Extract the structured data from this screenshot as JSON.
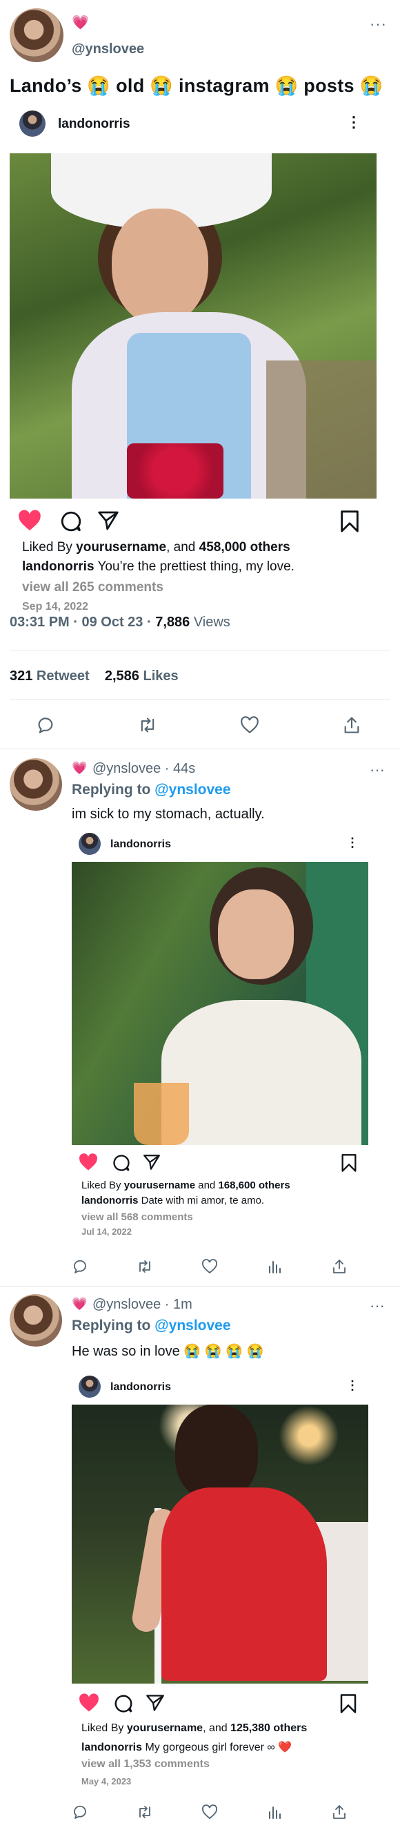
{
  "main_tweet": {
    "heart": "💗",
    "handle": "@ynslovee",
    "more": "···",
    "text": "Lando’s 😭 old 😭 instagram 😭 posts 😭",
    "time": "03:31 PM · 09 Oct 23 · ",
    "views_count": "7,886",
    "views_label": " Views",
    "retweets_count": "321",
    "retweets_label": " Retweet",
    "likes_count": "2,586",
    "likes_label": " Likes"
  },
  "ig_posts": [
    {
      "username": "landonorris",
      "more": "⋮",
      "liked_prefix": "Liked By ",
      "liked_user": "yourusername",
      "liked_mid": ", and ",
      "liked_count": "458,000 others",
      "caption_user": "landonorris",
      "caption": " You’re the prettiest thing, my love.",
      "comments": "view all 265 comments",
      "date": "Sep 14, 2022"
    },
    {
      "username": "landonorris",
      "more": "⋮",
      "liked_prefix": "Liked By ",
      "liked_user": "yourusername",
      "liked_mid": " and ",
      "liked_count": "168,600 others",
      "caption_user": "landonorris",
      "caption": " Date with mi amor, te amo.",
      "comments": "view all 568 comments",
      "date": "Jul 14, 2022"
    },
    {
      "username": "landonorris",
      "more": "⋮",
      "liked_prefix": "Liked By ",
      "liked_user": "yourusername",
      "liked_mid": ", and ",
      "liked_count": "125,380 others",
      "caption_user": "landonorris",
      "caption": " My gorgeous girl forever ∞ ❤️",
      "comments": "view all 1,353 comments",
      "date": "May 4, 2023"
    }
  ],
  "replies": [
    {
      "heart": "💗",
      "handle": "@ynslovee · 44s",
      "more": "···",
      "replying_prefix": "Replying to ",
      "replying_to": "@ynslovee",
      "text": "im sick to my stomach, actually."
    },
    {
      "heart": "💗",
      "handle": "@ynslovee · 1m",
      "more": "···",
      "replying_prefix": "Replying to ",
      "replying_to": "@ynslovee",
      "text": "He was so in love 😭 😭 😭 😭"
    }
  ],
  "colors": {
    "accent": "#1d9bf0",
    "secondary_text": "#536471",
    "like_pink": "#f91880",
    "ig_heart": "#ff3b6b",
    "ig_grey": "#8e8e8e"
  },
  "icons": [
    "heart-icon",
    "comment-icon",
    "send-icon",
    "bookmark-icon",
    "reply-icon",
    "retweet-icon",
    "like-icon",
    "share-icon",
    "analytics-icon"
  ]
}
